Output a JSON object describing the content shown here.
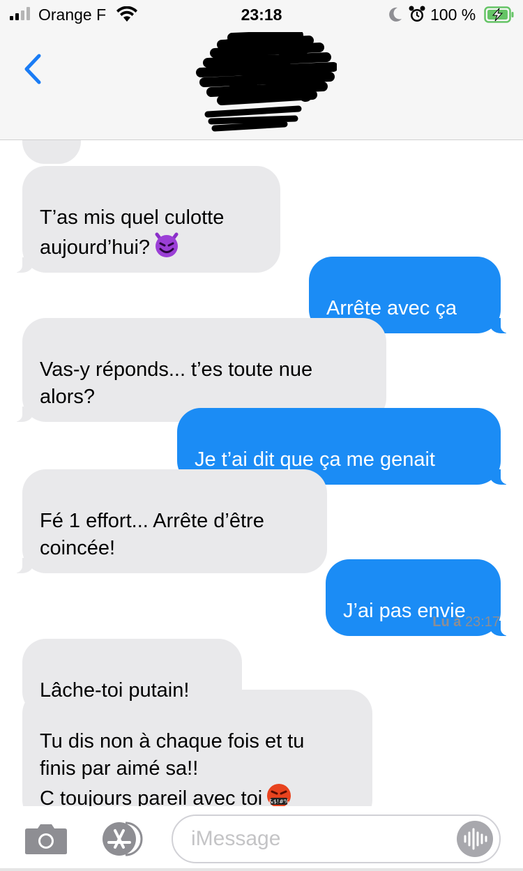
{
  "status_bar": {
    "carrier": "Orange F",
    "time": "23:18",
    "battery_percent": "100 %",
    "signal_bars": 4,
    "signal_active_bars": 2,
    "battery_color": "#65c466"
  },
  "header": {
    "back_icon": "chevron-left-icon",
    "accent": "#1a7cf5",
    "contact_name_redacted": true
  },
  "messages": [
    {
      "from": "contact",
      "text": "T’as mis quel culotte\naujourd’hui?",
      "emoji": "smiling-devil-emoji"
    },
    {
      "from": "me",
      "text": "Arrête avec ça"
    },
    {
      "from": "contact",
      "text": "Vas-y réponds... t’es toute nue\nalors?"
    },
    {
      "from": "me",
      "text": "Je t’ai dit que ça me genait"
    },
    {
      "from": "contact",
      "text": "Fé 1 effort... Arrête d’être\ncoincée!"
    },
    {
      "from": "me",
      "text": "J’ai pas envie"
    },
    {
      "from": "contact",
      "text": "Lâche-toi putain!"
    },
    {
      "from": "contact",
      "text": "Tu dis non à chaque fois et tu\nfinis par aimé sa!!\nC toujours pareil avec toi",
      "emoji": "face-with-symbols-on-mouth-emoji"
    }
  ],
  "read_receipt": {
    "label": "Lu à",
    "time": "23:17"
  },
  "composer": {
    "placeholder": "iMessage",
    "camera_icon": "camera-icon",
    "apps_icon": "app-store-icon",
    "audio_icon": "audio-waveform-icon"
  },
  "colors": {
    "sent_bubble": "#1b8cf5",
    "received_bubble": "#e9e9eb"
  }
}
